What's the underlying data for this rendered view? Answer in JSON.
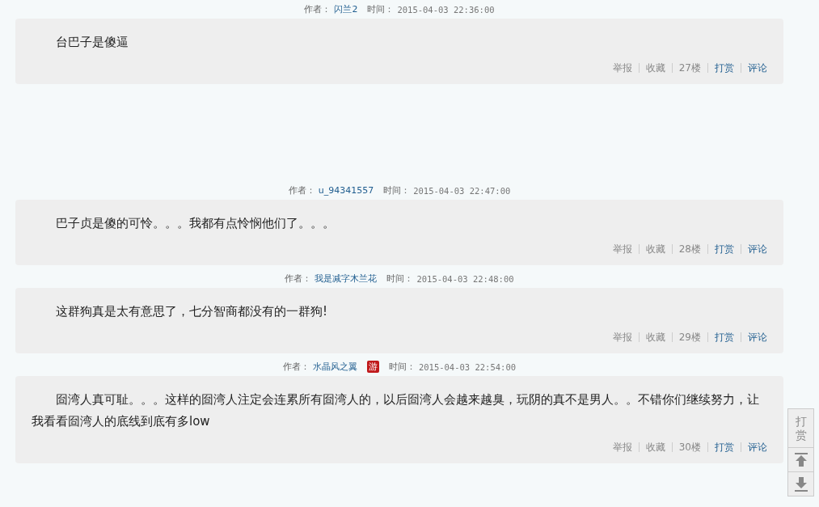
{
  "posts": [
    {
      "author_label": "作者：",
      "author": "闪兰2",
      "time_label": "时间：",
      "time": "2015-04-03 22:36:00",
      "body": "台巴子是傻逼",
      "actions": [
        {
          "label": "举报",
          "kind": "plain"
        },
        {
          "label": "收藏",
          "kind": "plain"
        },
        {
          "label": "27楼",
          "kind": "floor"
        },
        {
          "label": "打赏",
          "kind": "link"
        },
        {
          "label": "评论",
          "kind": "link"
        }
      ]
    },
    {
      "author_label": "作者：",
      "author": "u_94341557",
      "time_label": "时间：",
      "time": "2015-04-03 22:47:00",
      "body": "巴子贞是傻的可怜。。。我都有点怜悯他们了。。。",
      "actions": [
        {
          "label": "举报",
          "kind": "plain"
        },
        {
          "label": "收藏",
          "kind": "plain"
        },
        {
          "label": "28楼",
          "kind": "floor"
        },
        {
          "label": "打赏",
          "kind": "link"
        },
        {
          "label": "评论",
          "kind": "link"
        }
      ]
    },
    {
      "author_label": "作者：",
      "author": "我是减字木兰花",
      "time_label": "时间：",
      "time": "2015-04-03 22:48:00",
      "body": "这群狗真是太有意思了，七分智商都没有的一群狗!",
      "actions": [
        {
          "label": "举报",
          "kind": "plain"
        },
        {
          "label": "收藏",
          "kind": "plain"
        },
        {
          "label": "29楼",
          "kind": "floor"
        },
        {
          "label": "打赏",
          "kind": "link"
        },
        {
          "label": "评论",
          "kind": "link"
        }
      ]
    },
    {
      "author_label": "作者：",
      "author": "水晶风之翼",
      "badge": "游",
      "time_label": "时间：",
      "time": "2015-04-03 22:54:00",
      "body": "囼湾人真可耻。。。这样的囼湾人注定会连累所有囼湾人的，以后囼湾人会越来越臭，玩阴的真不是男人。。不错你们继续努力，让我看看囼湾人的底线到底有多low",
      "actions": [
        {
          "label": "举报",
          "kind": "plain"
        },
        {
          "label": "收藏",
          "kind": "plain"
        },
        {
          "label": "30楼",
          "kind": "floor"
        },
        {
          "label": "打赏",
          "kind": "link"
        },
        {
          "label": "评论",
          "kind": "link"
        }
      ]
    }
  ],
  "side_tools": {
    "reward_label": "打赏"
  }
}
